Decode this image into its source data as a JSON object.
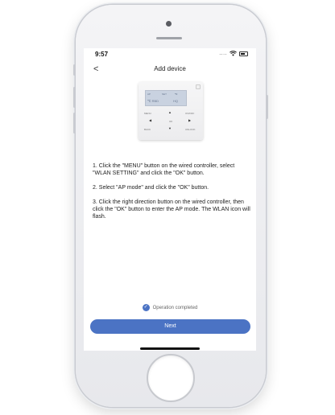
{
  "status_bar": {
    "time": "9:57",
    "signal": "....",
    "wifi_icon": "wifi-icon",
    "battery_icon": "battery-icon"
  },
  "header": {
    "back_icon": "chevron-left-icon",
    "back_glyph": "<",
    "title": "Add device"
  },
  "controller": {
    "lcd_texts": [
      "AP",
      "NET",
      "℃",
      "℃ RBD",
      "HQ"
    ],
    "buttons": {
      "menu": "MENU",
      "onoff": "ON/OFF",
      "ok": "OK",
      "back": "BACK",
      "unlock": "UNLOCK"
    },
    "arrows": {
      "up": "▲",
      "down": "▼",
      "left": "◀",
      "right": "▶"
    }
  },
  "instructions": [
    "1. Click the \"MENU\" button on the wired controller, select \"WLAN SETTING\" and click the \"OK\" button.",
    "2. Select \"AP mode\" and click the \"OK\" button.",
    "3. Click the right direction button on the wired controller, then click the \"OK\" button to enter the AP mode. The WLAN  icon will flash."
  ],
  "completed": {
    "icon": "check-circle-icon",
    "glyph": "✓",
    "label": "Operation completed"
  },
  "next_label": "Next",
  "colors": {
    "accent": "#4b73c4"
  }
}
